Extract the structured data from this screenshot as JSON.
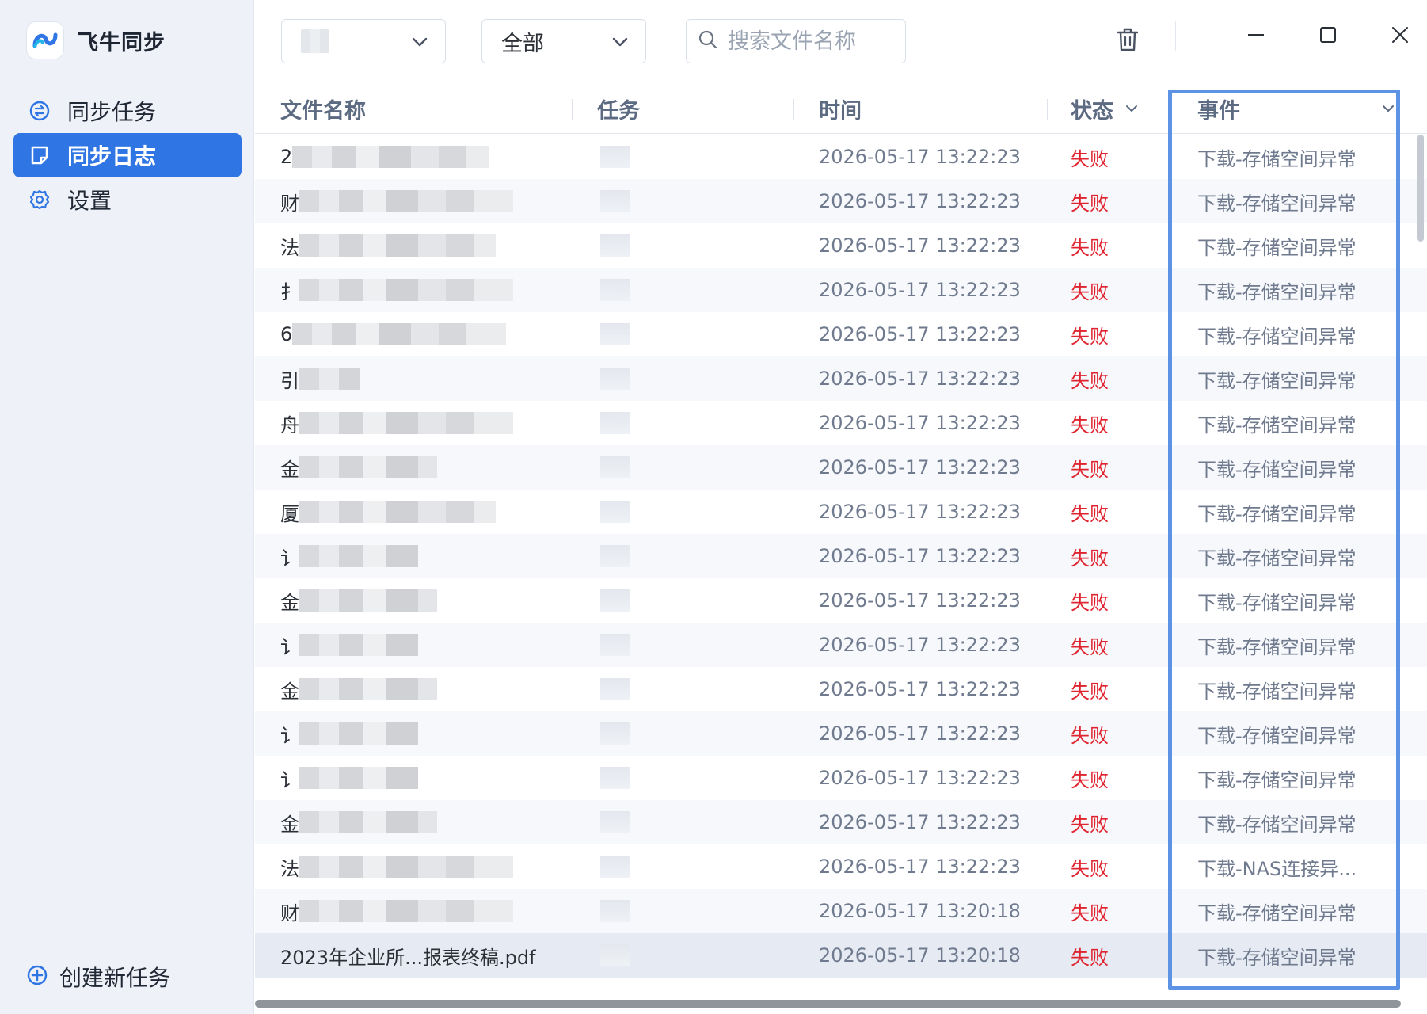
{
  "app": {
    "name": "飞牛同步",
    "brand_color": "#2f75e3"
  },
  "sidebar": {
    "items": [
      {
        "label": "同步任务",
        "icon": "sync-task-icon",
        "active": false
      },
      {
        "label": "同步日志",
        "icon": "log-note-icon",
        "active": true
      },
      {
        "label": "设置",
        "icon": "gear-icon",
        "active": false
      }
    ],
    "create_task_label": "创建新任务"
  },
  "toolbar": {
    "task_select_value": "",
    "type_select_value": "全部",
    "search_placeholder": "搜索文件名称",
    "delete_icon": "trash-icon",
    "window_controls": [
      "minimize-icon",
      "maximize-icon",
      "close-icon"
    ]
  },
  "table": {
    "columns": [
      "文件名称",
      "任务",
      "时间",
      "状态",
      "事件"
    ],
    "rows": [
      {
        "name": "2",
        "task": "",
        "time": "2026-05-17 13:22:23",
        "status": "失败",
        "event": "下载-存储空间异常"
      },
      {
        "name": "财",
        "task": "",
        "time": "2026-05-17 13:22:23",
        "status": "失败",
        "event": "下载-存储空间异常"
      },
      {
        "name": "法",
        "task": "",
        "time": "2026-05-17 13:22:23",
        "status": "失败",
        "event": "下载-存储空间异常"
      },
      {
        "name": "扌",
        "task": "",
        "time": "2026-05-17 13:22:23",
        "status": "失败",
        "event": "下载-存储空间异常"
      },
      {
        "name": "6",
        "task": "",
        "time": "2026-05-17 13:22:23",
        "status": "失败",
        "event": "下载-存储空间异常"
      },
      {
        "name": "引",
        "task": "",
        "time": "2026-05-17 13:22:23",
        "status": "失败",
        "event": "下载-存储空间异常"
      },
      {
        "name": "舟",
        "task": "",
        "time": "2026-05-17 13:22:23",
        "status": "失败",
        "event": "下载-存储空间异常"
      },
      {
        "name": "金",
        "task": "",
        "time": "2026-05-17 13:22:23",
        "status": "失败",
        "event": "下载-存储空间异常"
      },
      {
        "name": "厦",
        "task": "",
        "time": "2026-05-17 13:22:23",
        "status": "失败",
        "event": "下载-存储空间异常"
      },
      {
        "name": "讠",
        "task": "",
        "time": "2026-05-17 13:22:23",
        "status": "失败",
        "event": "下载-存储空间异常"
      },
      {
        "name": "金",
        "task": "",
        "time": "2026-05-17 13:22:23",
        "status": "失败",
        "event": "下载-存储空间异常"
      },
      {
        "name": "讠",
        "task": "",
        "time": "2026-05-17 13:22:23",
        "status": "失败",
        "event": "下载-存储空间异常"
      },
      {
        "name": "金",
        "task": "",
        "time": "2026-05-17 13:22:23",
        "status": "失败",
        "event": "下载-存储空间异常"
      },
      {
        "name": "讠",
        "task": "",
        "time": "2026-05-17 13:22:23",
        "status": "失败",
        "event": "下载-存储空间异常"
      },
      {
        "name": "讠",
        "task": "",
        "time": "2026-05-17 13:22:23",
        "status": "失败",
        "event": "下载-存储空间异常"
      },
      {
        "name": "金",
        "task": "",
        "time": "2026-05-17 13:22:23",
        "status": "失败",
        "event": "下载-存储空间异常"
      },
      {
        "name": "法",
        "task": "",
        "time": "2026-05-17 13:22:23",
        "status": "失败",
        "event": "下载-NAS连接异..."
      },
      {
        "name": "财",
        "task": "",
        "time": "2026-05-17 13:20:18",
        "status": "失败",
        "event": "下载-存储空间异常"
      },
      {
        "name": "2023年企业所...报表终稿.pdf",
        "task": "",
        "time": "2026-05-17 13:20:18",
        "status": "失败",
        "event": "下载-存储空间异常"
      }
    ],
    "colors": {
      "status_fail": "#e0242f",
      "highlight_border": "#5d93e4"
    }
  }
}
